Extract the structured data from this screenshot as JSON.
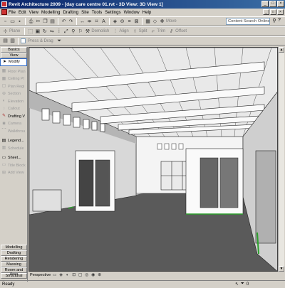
{
  "window": {
    "title": "Revit Architecture 2009 - [day care centre 01.rvt - 3D View: 3D View 1]",
    "controls": [
      "_",
      "□",
      "×"
    ]
  },
  "menu": [
    "File",
    "Edit",
    "View",
    "Modelling",
    "Drafting",
    "Site",
    "Tools",
    "Settings",
    "Window",
    "Help"
  ],
  "toolbar2": {
    "items": [
      "Plane",
      "Demolish",
      "Align",
      "Split",
      "Trim",
      "Offset"
    ]
  },
  "toolbar1": {
    "move_label": "Move"
  },
  "search": {
    "placeholder": "Content Search Online"
  },
  "options_bar": {
    "press_drag": "Press & Drag"
  },
  "design_bar": {
    "tab_basics": "Basics",
    "tab_view": "View",
    "modify": "Modify",
    "items": [
      "Floor Plan",
      "Ceiling Pl",
      "Plan Regi",
      "Section",
      "Elevation",
      "Callout",
      "Drafting V",
      "Camera",
      "Walkthrou",
      "Legend...",
      "Schedule",
      "Sheet...",
      "Title Block",
      "Add View"
    ],
    "bottom_tabs": [
      "Modelling",
      "Drafting",
      "Rendering",
      "Massing",
      "Room and Area",
      "Structural"
    ]
  },
  "view_control": {
    "scale": "Perspective"
  },
  "status": {
    "text": "Ready",
    "filter_count": "0"
  },
  "colors": {
    "title_start": "#0a246a",
    "title_end": "#3a6ea5",
    "selected_bg": "#ffffff",
    "accent_green": "#2ca02c"
  }
}
